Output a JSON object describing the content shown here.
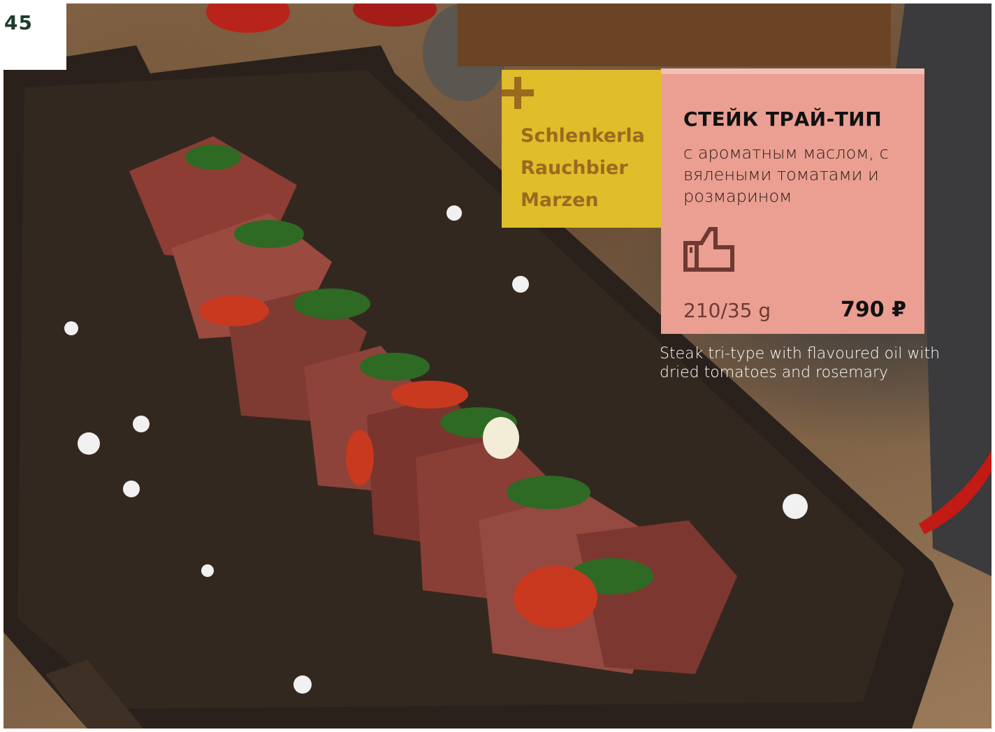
{
  "page": {
    "number": "45"
  },
  "pairing": {
    "icon": "plus-icon",
    "name": "Schlenkerla\nRauchbier\nMarzen"
  },
  "dish": {
    "title_ru": "СТЕЙК ТРАЙ-ТИП",
    "description_ru": "с ароматным маслом, с вялеными томатами и розмарином",
    "badge_icon": "thumbs-up-icon",
    "weight": "210/35 g",
    "price": "790 ₽",
    "description_en": "Steak tri-type with flavoured oil with dried tomatoes and rosemary"
  },
  "colors": {
    "page_number": "#1f3b2e",
    "pairing_bg": "#e0bd2a",
    "pairing_text": "#9a6a1e",
    "card_bg": "#ea9f92",
    "icon_stroke": "#6e3a32"
  }
}
